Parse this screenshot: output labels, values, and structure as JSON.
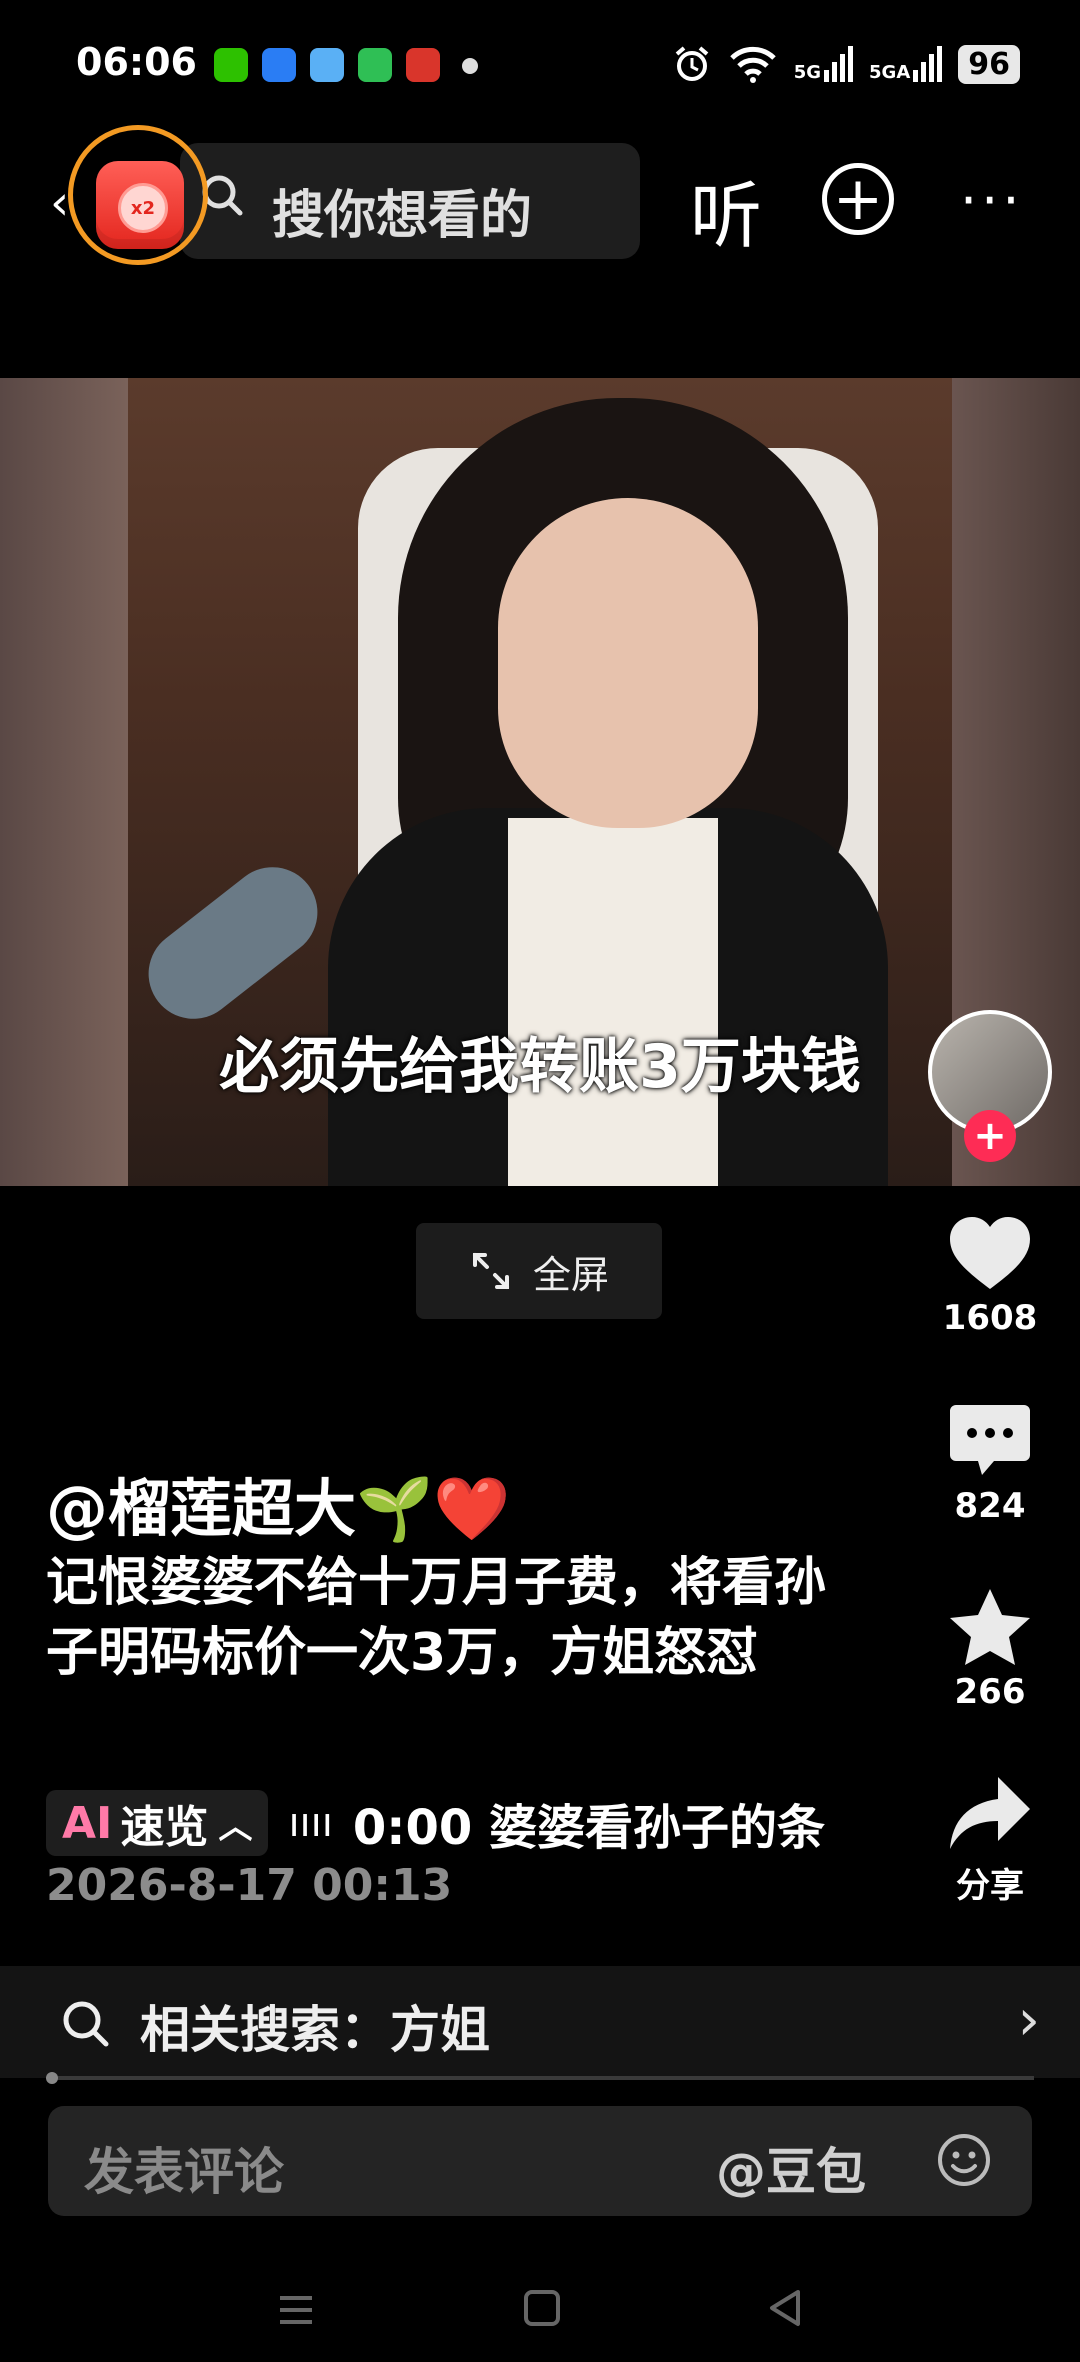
{
  "status_bar": {
    "time": "06:06",
    "battery": "96",
    "signal_1": "5G",
    "signal_2": "5GA"
  },
  "top_bar": {
    "search_placeholder": "搜你想看的",
    "listen_label": "听",
    "red_packet_label": "x2"
  },
  "video": {
    "subtitle": "必须先给我转账3万块钱",
    "fullscreen_label": "全屏"
  },
  "actions": {
    "likes": "1608",
    "comments": "824",
    "favorites": "266",
    "share_label": "分享"
  },
  "post": {
    "author": "@榴莲超大🌱❤️",
    "description": "记恨婆婆不给十万月子费，将看孙子明码标价一次3万，方姐怒怼",
    "ai_prefix": "AI",
    "ai_label": "速览",
    "ai_summary": "0:00 婆婆看孙子的条",
    "date": "2026-8-17 00:13"
  },
  "related_search": {
    "label": "相关搜索：方姐"
  },
  "comment_bar": {
    "placeholder": "发表评论",
    "at_label": "@豆包"
  },
  "colors": {
    "accent_red": "#fe2c55",
    "highlight_ring": "#f39a23"
  }
}
